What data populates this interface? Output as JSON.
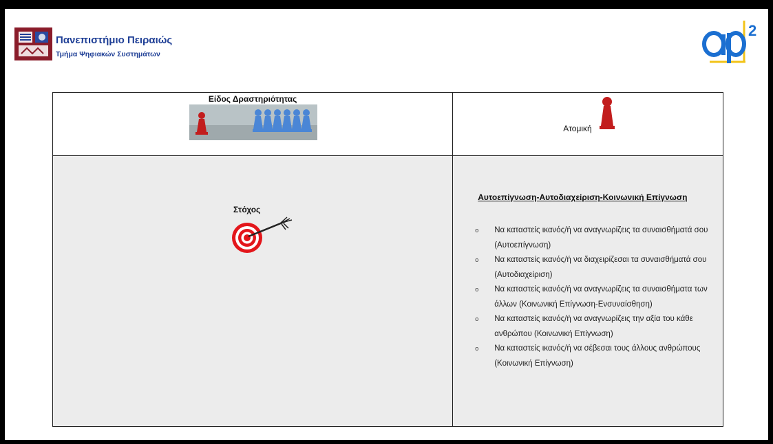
{
  "header": {
    "university_name": "Πανεπιστήμιο Πειραιώς",
    "department_name": "Τμήμα Ψηφιακών Συστημάτων",
    "apt_logo": "apt²"
  },
  "table": {
    "activity_type_heading": "Είδος Δραστηριότητας",
    "activity_type_value": "Ατομική",
    "goal_label": "Στόχος",
    "objectives_heading": "Αυτοεπίγνωση-Αυτοδιαχείριση-Κοινωνική Επίγνωση",
    "objectives": [
      "Να καταστείς ικανός/ή να αναγνωρίζεις τα συναισθήματά σου (Αυτοεπίγνωση)",
      " Να καταστείς ικανός/ή να διαχειρίζεσαι τα συναισθήματά σου (Αυτοδιαχείριση)",
      "Να καταστείς ικανός/ή να αναγνωρίζεις τα συναισθήματα των άλλων (Κοινωνική Επίγνωση-Ενσυναίσθηση)",
      "Να καταστείς ικανός/ή να αναγνωρίζεις την αξία του κάθε ανθρώπου (Κοινωνική Επίγνωση)",
      "Να καταστείς ικανός/ή να σέβεσαι τους άλλους ανθρώπους (Κοινωνική Επίγνωση)"
    ],
    "bullet_symbol": "o"
  },
  "icons": {
    "university_logo": "university-crest-icon",
    "activity_photo": "red-pawn-vs-blue-pawns-icon",
    "individual": "red-pawn-icon",
    "goal": "target-arrow-icon"
  },
  "colors": {
    "university_blue": "#1f3f96",
    "apt_blue": "#1b6fd1",
    "apt_yellow": "#f2c318",
    "pawn_red": "#c21d1d",
    "target_red": "#e3161b"
  }
}
